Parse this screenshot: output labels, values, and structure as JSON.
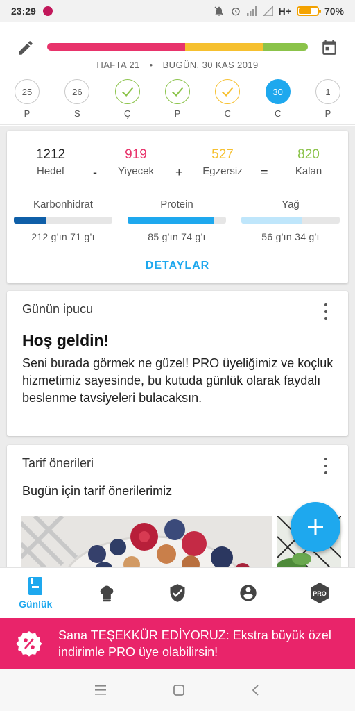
{
  "status_bar": {
    "time": "23:29",
    "network": "H+",
    "battery_text": "70%",
    "battery_level": 0.7,
    "icons": [
      "notification-app-icon",
      "mute-icon",
      "alarm-icon",
      "signal-icon",
      "no-signal-icon",
      "battery-icon"
    ]
  },
  "header": {
    "edit_icon": "pencil-icon",
    "calendar_icon": "calendar-icon",
    "week_label": "HAFTA 21",
    "separator": "•",
    "today_label": "BUGÜN, 30 KAS 2019",
    "progress_segments": [
      {
        "fraction": 0.53,
        "color": "#e8336b"
      },
      {
        "fraction": 0.3,
        "color": "#f6c02f"
      },
      {
        "fraction": 0.17,
        "color": "#8bc34a"
      }
    ],
    "days": [
      {
        "number": "25",
        "letter": "P",
        "state": "empty"
      },
      {
        "number": "26",
        "letter": "S",
        "state": "empty"
      },
      {
        "number": "",
        "letter": "Ç",
        "state": "done"
      },
      {
        "number": "",
        "letter": "P",
        "state": "done"
      },
      {
        "number": "",
        "letter": "C",
        "state": "partial"
      },
      {
        "number": "30",
        "letter": "C",
        "state": "today"
      },
      {
        "number": "1",
        "letter": "P",
        "state": "empty"
      }
    ]
  },
  "summary": {
    "goal": {
      "value": "1212",
      "label": "Hedef"
    },
    "minus": "-",
    "food": {
      "value": "919",
      "label": "Yiyecek",
      "color": "#e8336b"
    },
    "plus": "+",
    "exercise": {
      "value": "527",
      "label": "Egzersiz",
      "color": "#f6c02f"
    },
    "equals": "=",
    "remaining": {
      "value": "820",
      "label": "Kalan",
      "color": "#8bc34a"
    },
    "macros": [
      {
        "title": "Karbonhidrat",
        "text": "212 g'ın 71 g'ı",
        "fraction": 0.33,
        "color": "#0f5fa8"
      },
      {
        "title": "Protein",
        "text": "85 g'ın 74 g'ı",
        "fraction": 0.87,
        "color": "#1ea8ee"
      },
      {
        "title": "Yağ",
        "text": "56 g'ın 34 g'ı",
        "fraction": 0.61,
        "color": "#bfe6fb"
      }
    ],
    "details_label": "DETAYLAR"
  },
  "tip_card": {
    "title": "Günün ipucu",
    "heading": "Hoş geldin!",
    "body": "Seni burada görmek ne güzel! PRO üyeliğimiz ve koçluk hizmetimiz sayesinde, bu kutuda günlük olarak faydalı beslenme tavsiyeleri bulacaksın."
  },
  "recipe_card": {
    "title": "Tarif önerileri",
    "subtitle": "Bugün için tarif önerilerimiz"
  },
  "fab": {
    "icon": "plus-icon"
  },
  "bottom_nav": {
    "items": [
      {
        "name": "diary",
        "label": "Günlük",
        "icon": "diary-icon",
        "active": true
      },
      {
        "name": "recipes",
        "label": "",
        "icon": "chef-hat-icon",
        "active": false
      },
      {
        "name": "shield",
        "label": "",
        "icon": "shield-check-icon",
        "active": false
      },
      {
        "name": "profile",
        "label": "",
        "icon": "account-icon",
        "active": false
      },
      {
        "name": "pro",
        "label": "",
        "icon": "pro-badge-icon",
        "active": false
      }
    ],
    "pro_text": "PRO",
    "active_color": "#1ea8ee"
  },
  "banner": {
    "text": "Sana TEŞEKKÜR EDİYORUZ: Ekstra büyük özel indirimle PRO üye olabilirsin!",
    "background": "#e9246a",
    "icon": "discount-badge-icon"
  },
  "system_nav": {
    "icons": [
      "menu-icon",
      "home-icon",
      "back-icon"
    ]
  }
}
